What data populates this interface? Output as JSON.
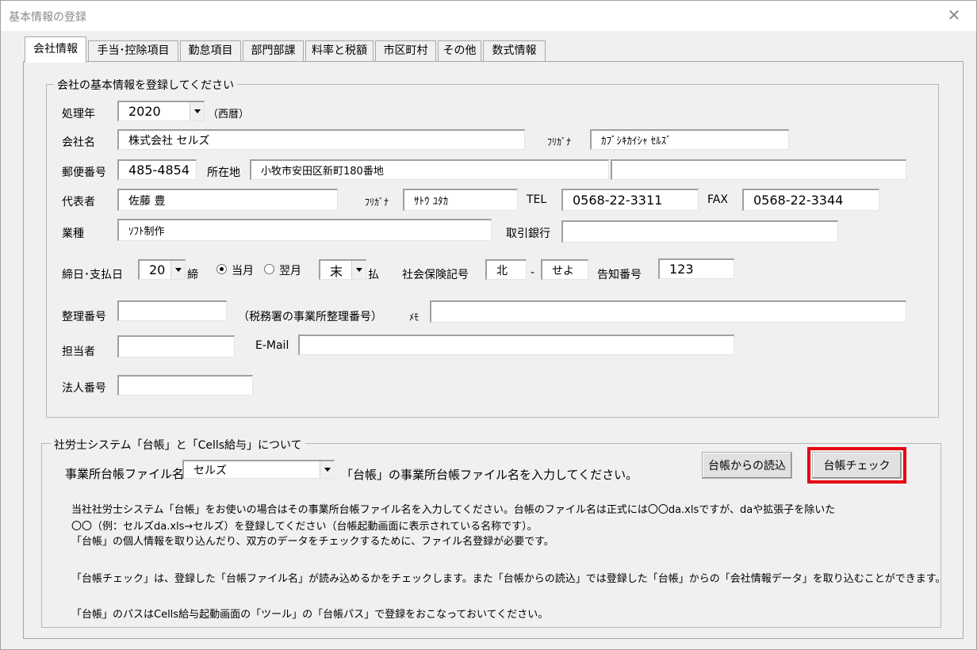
{
  "window": {
    "title": "基本情報の登録",
    "close_icon": "close-icon"
  },
  "tabs": [
    "会社情報",
    "手当･控除項目",
    "勤怠項目",
    "部門部課",
    "料率と税額",
    "市区町村",
    "その他",
    "数式情報"
  ],
  "company": {
    "legend": "会社の基本情報を登録してください",
    "year_label": "処理年",
    "year_value": "2020",
    "year_note": "（西暦）",
    "name_label": "会社名",
    "name_value": "株式会社  セルズ",
    "furigana_label": "ﾌﾘｶﾞﾅ",
    "furigana_value": "ｶﾌﾞｼｷｶｲｼｬ ｾﾙｽﾞ",
    "postal_label": "郵便番号",
    "postal_value": "485-4854",
    "address_label": "所在地",
    "address_value": "小牧市安田区新町180番地",
    "address2_value": "",
    "rep_label": "代表者",
    "rep_value": "佐藤  豊",
    "rep_furigana_label": "ﾌﾘｶﾞﾅ",
    "rep_furigana_value": "ｻﾄｳ ﾕﾀｶ",
    "tel_label": "TEL",
    "tel_value": "0568-22-3311",
    "fax_label": "FAX",
    "fax_value": "0568-22-3344",
    "industry_label": "業種",
    "industry_value": "ｿﾌﾄ制作",
    "bank_label": "取引銀行",
    "bank_value": "",
    "closing_label": "締日･支払日",
    "closing_value": "20",
    "closing_suffix": "締",
    "radio_current": "当月",
    "radio_next": "翌月",
    "pay_value": "末",
    "pay_suffix": "払",
    "insurance_label": "社会保険記号",
    "insurance_a": "北",
    "insurance_dash": "-",
    "insurance_b": "せよ",
    "notice_label": "告知番号",
    "notice_value": "123",
    "ref_label": "整理番号",
    "ref_value": "",
    "ref_note": "（税務署の事業所整理番号）",
    "memo_label": "ﾒﾓ",
    "memo_value": "",
    "person_label": "担当者",
    "person_value": "",
    "email_label": "E-Mail",
    "email_value": "",
    "corp_label": "法人番号",
    "corp_value": ""
  },
  "ledger": {
    "legend": "社労士システム「台帳」と「Cells給与」について",
    "file_label": "事業所台帳ファイル名",
    "file_value": "セルズ",
    "file_hint": "「台帳」の事業所台帳ファイル名を入力してください。",
    "read_button": "台帳からの読込",
    "check_button": "台帳チェック",
    "notes": [
      "当社社労士システム「台帳」をお使いの場合はその事業所台帳ファイル名を入力してください。台帳のファイル名は正式には〇〇da.xlsですが、daや拡張子を除いた",
      "〇〇（例：セルズda.xls→セルズ）を登録してください（台帳起動画面に表示されている名称です）。",
      "「台帳」の個人情報を取り込んだり、双方のデータをチェックするために、ファイル名登録が必要です。",
      "「台帳チェック」は、登録した「台帳ファイル名」が読み込めるかをチェックします。また「台帳からの読込」では登録した「台帳」からの「会社情報データ」を取り込むことができます。",
      "「台帳」のパスはCells給与起動画面の「ツール」の「台帳パス」で登録をおこなっておいてください。"
    ]
  },
  "colors": {
    "highlight": "#e60012"
  }
}
